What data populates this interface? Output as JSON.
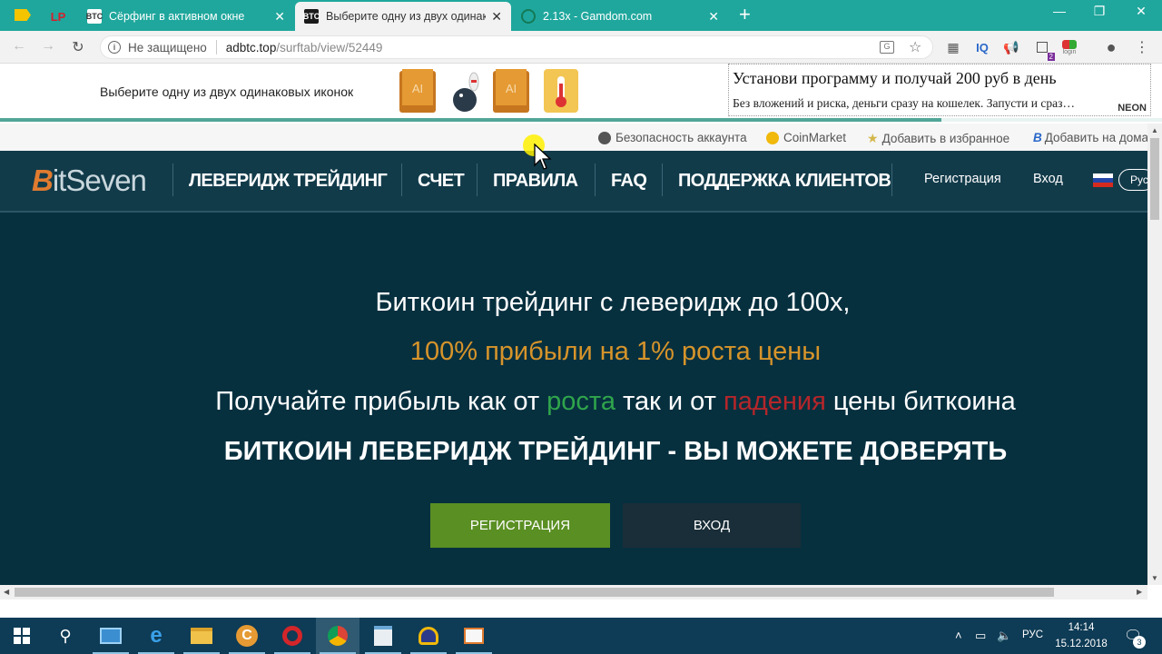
{
  "browser": {
    "tabs": [
      {
        "favicon": "LP",
        "title": "",
        "active": false
      },
      {
        "favicon": "BTC",
        "title": "Сёрфинг в активном окне",
        "active": false
      },
      {
        "favicon": "BTC",
        "title": "Выберите одну из двух одинаковых",
        "active": true
      },
      {
        "favicon": "",
        "title": "2.13x - Gamdom.com",
        "active": false
      }
    ],
    "new_tab_label": "+",
    "address": {
      "security": "Не защищено",
      "host": "adbtc.top",
      "path": "/surftab/view/52449"
    },
    "ext_badge": "2",
    "ext_login": "login",
    "ext_iq": "IQ"
  },
  "surf": {
    "instruction": "Выберите одну из двух одинаковых иконок",
    "icon_label": "AI",
    "progress": 0.81,
    "ad": {
      "title": "Установи программу и получай 200 руб в день",
      "text": "Без вложений и риска, деньги сразу на кошелек. Запусти и сраз…",
      "brand": "NEON"
    }
  },
  "site": {
    "toplinks": [
      {
        "label": "Безопасность аккаунта",
        "icon": "shield-icon"
      },
      {
        "label": "CoinMarket",
        "icon": "coin-icon"
      },
      {
        "label": "Добавить в избранное",
        "icon": "star-icon"
      },
      {
        "label": "Добавить на дома",
        "icon": "b-icon"
      }
    ],
    "logo": {
      "prefix": "B",
      "rest": "itSeven"
    },
    "nav": [
      "ЛЕВЕРИДЖ ТРЕЙДИНГ",
      "СЧЕТ",
      "ПРАВИЛА",
      "FAQ",
      "ПОДДЕРЖКА КЛИЕНТОВ"
    ],
    "register_link": "Регистрация",
    "login_link": "Вход",
    "lang": "Рус",
    "hero": {
      "line1": "Биткоин трейдинг с леверидж до 100х,",
      "line2": "100% прибыли на 1% роста цены",
      "line3_a": "Получайте прибыль как от ",
      "line3_up": "роста",
      "line3_b": " так и от ",
      "line3_down": "падения",
      "line3_c": " цены биткоина",
      "line4": "БИТКОИН ЛЕВЕРИДЖ ТРЕЙДИНГ - ВЫ МОЖЕТЕ ДОВЕРЯТЬ",
      "register_button": "РЕГИСТРАЦИЯ",
      "login_button": "ВХОД"
    }
  },
  "taskbar": {
    "lang": "РУС",
    "time": "14:14",
    "date": "15.12.2018",
    "notifications": "3"
  },
  "colors": {
    "tabstrip": "#1fa79d",
    "hero_bg": "#07303f",
    "header_bg": "#123b4a",
    "accent_orange": "#d7942a",
    "up_green": "#2fa54b",
    "down_red": "#b5262a",
    "register_green": "#5a8f23"
  }
}
